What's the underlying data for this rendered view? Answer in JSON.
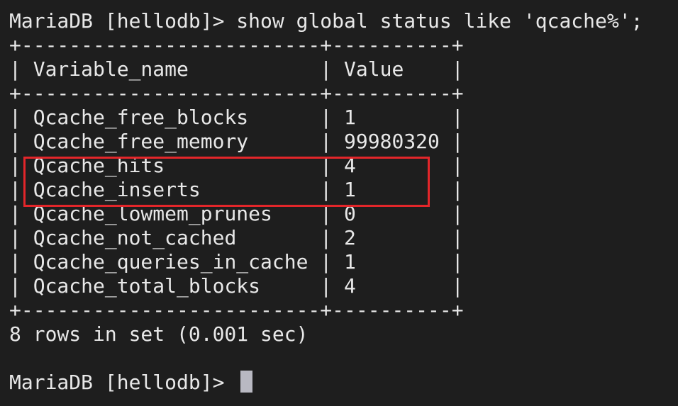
{
  "terminal": {
    "prompt": "MariaDB [hellodb]> ",
    "command": "show global status like 'qcache%';",
    "separator": "+-------------------------+----------+",
    "headers": [
      "Variable_name",
      "Value"
    ],
    "rows": [
      {
        "name": "Qcache_free_blocks",
        "value": "1"
      },
      {
        "name": "Qcache_free_memory",
        "value": "99980320"
      },
      {
        "name": "Qcache_hits",
        "value": "4"
      },
      {
        "name": "Qcache_inserts",
        "value": "1"
      },
      {
        "name": "Qcache_lowmem_prunes",
        "value": "0"
      },
      {
        "name": "Qcache_not_cached",
        "value": "2"
      },
      {
        "name": "Qcache_queries_in_cache",
        "value": "1"
      },
      {
        "name": "Qcache_total_blocks",
        "value": "4"
      }
    ],
    "result_summary": "8 rows in set (0.001 sec)",
    "final_prompt": "MariaDB [hellodb]> "
  },
  "colors": {
    "background": "#1e1e1e",
    "text": "#e8e8e8",
    "cursor": "#b9b9c2",
    "highlight": "#e3262a"
  },
  "icons": {
    "cursor": "terminal-cursor-block"
  }
}
